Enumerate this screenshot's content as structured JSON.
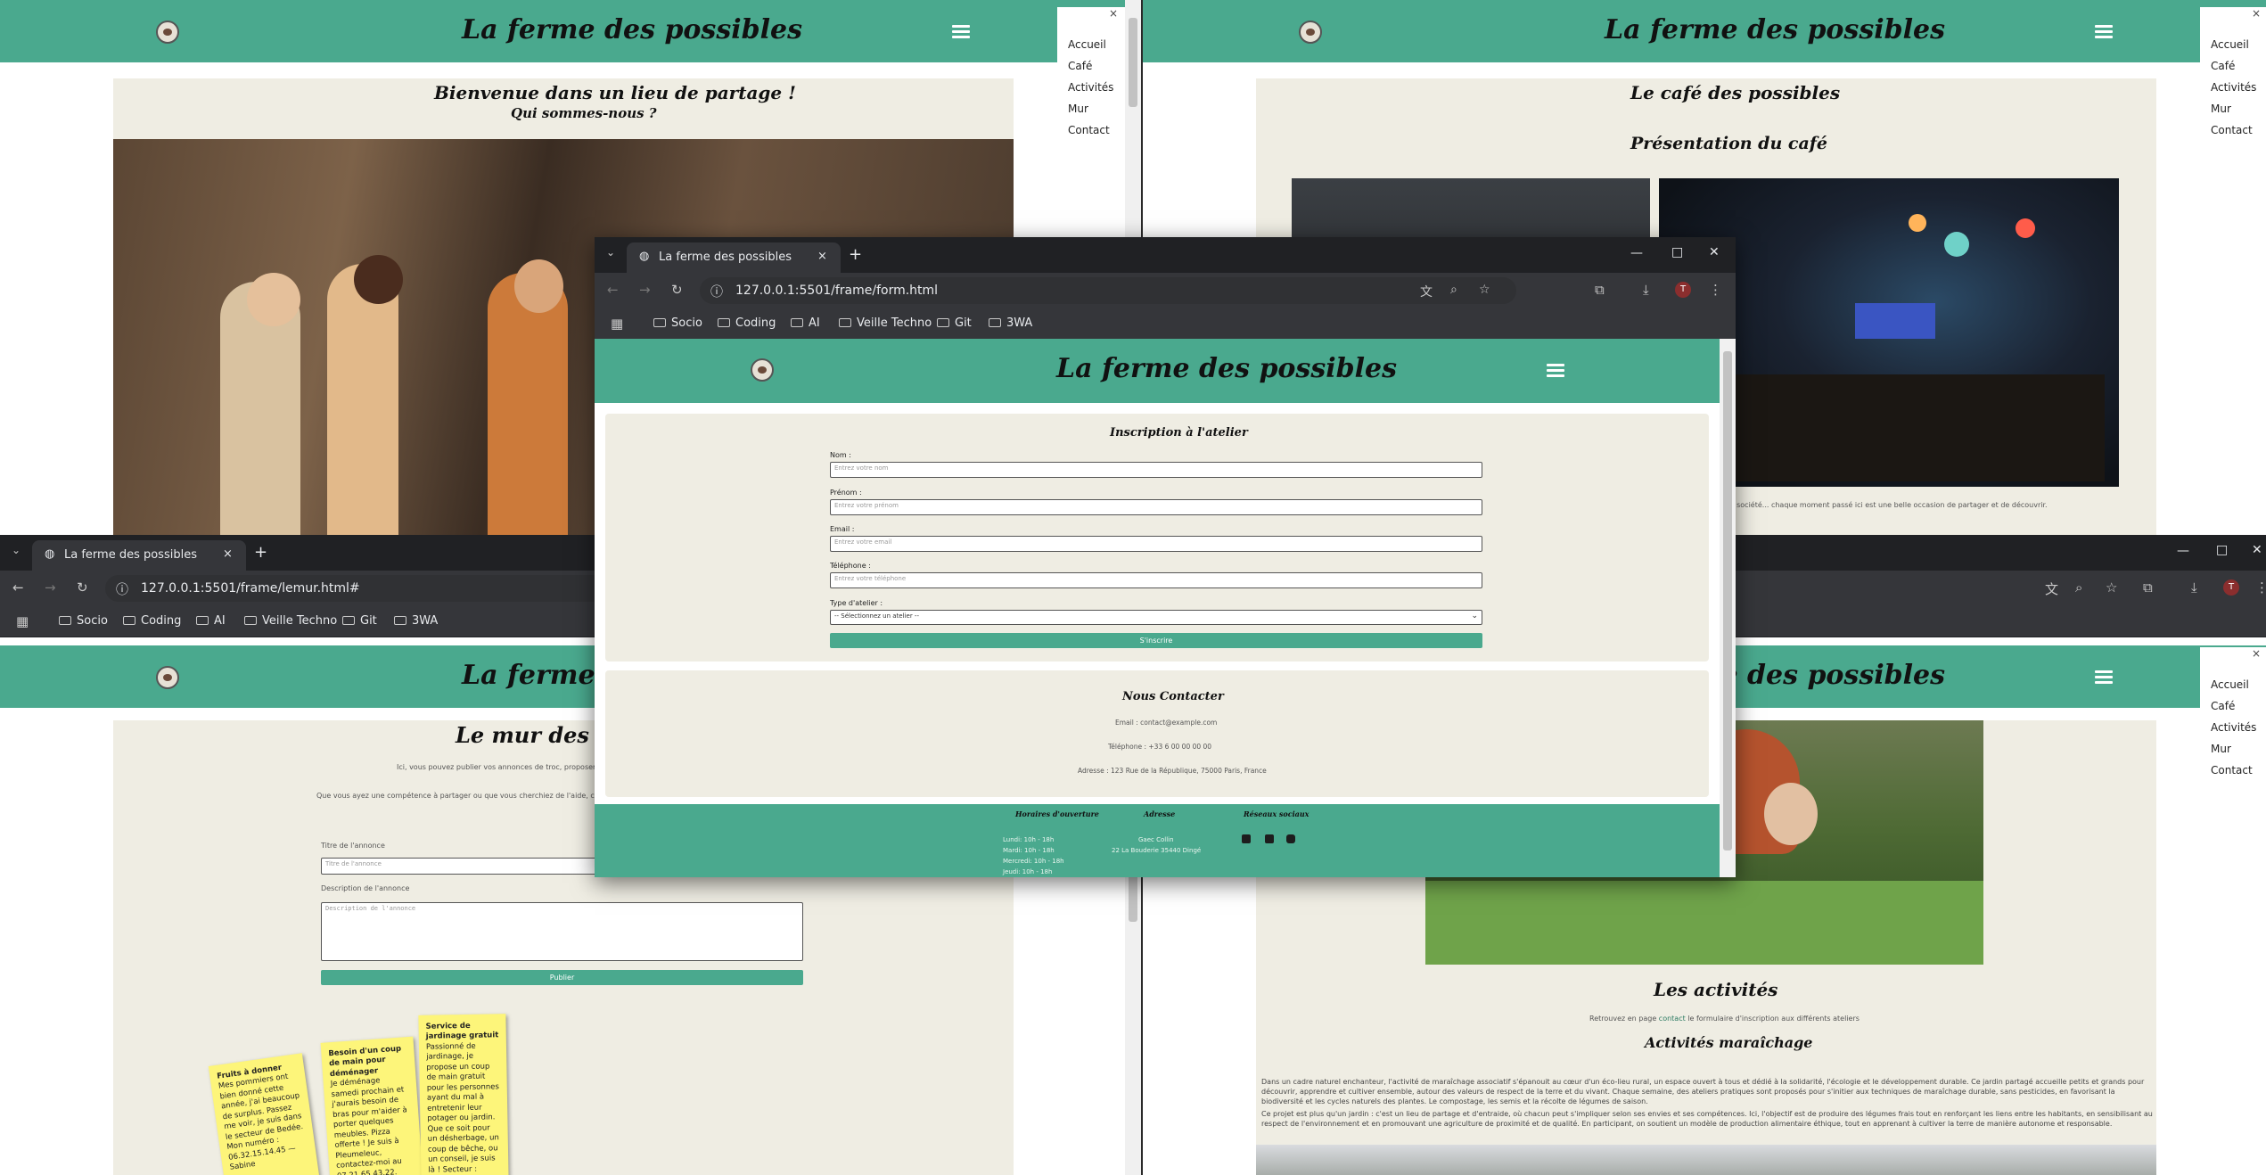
{
  "site": {
    "brand": "La ferme des possibles"
  },
  "nav": {
    "items": [
      "Accueil",
      "Café",
      "Activités",
      "Mur",
      "Contact"
    ],
    "close": "×"
  },
  "win_home": {
    "heading": "Bienvenue dans un lieu de partage !",
    "subheading": "Qui sommes-nous ?"
  },
  "win_cafe": {
    "heading": "Le café des possibles",
    "subheading": "Présentation du café",
    "caption": "arts,lectures, jeux de société... chaque moment passé ici est une belle occasion de partager et de découvrir."
  },
  "win_mur": {
    "tab": {
      "title": "La ferme des possibles",
      "close": "×",
      "new": "+"
    },
    "url": "127.0.0.1:5501/frame/lemur.html#",
    "heading": "Le mur des petites",
    "intro1": "Ici, vous pouvez publier vos annonces de troc, proposer un coup",
    "intro2": "Que vous ayez une compétence à partager ou que vous cherchiez de l'aide, cet espace est",
    "title_label": "Titre de l'annonce",
    "title_placeholder": "Titre de l'annonce",
    "desc_label": "Description de l'annonce",
    "desc_placeholder": "Description de l'annonce",
    "publish": "Publier",
    "notes": [
      {
        "title": "Fruits à donner",
        "body": "Mes pommiers ont bien donné cette année, j'ai beaucoup de surplus. Passez me voir, je suis dans le secteur de Bedée. Mon numéro : 06.32.15.14.45 — Sabine"
      },
      {
        "title": "Besoin d'un coup de main pour déménager",
        "body": "Je déménage samedi prochain et j'aurais besoin de bras pour m'aider à porter quelques meubles. Pizza offerte ! Je suis à Pleumeleuc, contactez-moi au 07.21.65.43.22. Merci !"
      },
      {
        "title": "Service de jardinage gratuit",
        "body": "Passionné de jardinage, je propose un coup de main gratuit pour les personnes ayant du mal à entretenir leur potager ou jardin. Que ce soit pour un désherbage, un coup de bêche, ou un conseil, je suis là ! Secteur : Montfort-sur-"
      }
    ]
  },
  "win_activites": {
    "heading": "Les activités",
    "intro_prefix": "Retrouvez en page ",
    "intro_link": "contact",
    "intro_suffix": " le formulaire d'inscription aux différents ateliers",
    "subheading": "Activités maraîchage",
    "p1": "Dans un cadre naturel enchanteur, l'activité de maraîchage associatif s'épanouit au cœur d'un éco-lieu rural, un espace ouvert à tous et dédié à la solidarité, l'écologie et le développement durable. Ce jardin partagé accueille petits et grands pour découvrir, apprendre et cultiver ensemble, autour des valeurs de respect de la terre et du vivant. Chaque semaine, des ateliers pratiques sont proposés pour s'initier aux techniques de maraîchage durable, sans pesticides, en favorisant la biodiversité et les cycles naturels des plantes. Le compostage, les semis et la récolte de légumes de saison.",
    "p2": "Ce projet est plus qu'un jardin : c'est un lieu de partage et d'entraide, où chacun peut s'impliquer selon ses envies et ses compétences. Ici, l'objectif est de produire des légumes frais tout en renforçant les liens entre les habitants, en sensibilisant au respect de l'environnement et en promouvant une agriculture de proximité et de qualité. En participant, on soutient un modèle de production alimentaire éthique, tout en apprenant à cultiver la terre de manière autonome et responsable."
  },
  "win_form": {
    "tab": {
      "title": "La ferme des possibles",
      "close": "×",
      "new": "+"
    },
    "url": "127.0.0.1:5501/frame/form.html",
    "bookmarks": [
      "Socio",
      "Coding",
      "AI",
      "Veille Techno",
      "Git",
      "3WA"
    ],
    "form_title": "Inscription à l'atelier",
    "fields": [
      {
        "label": "Nom :",
        "placeholder": "Entrez votre nom"
      },
      {
        "label": "Prénom :",
        "placeholder": "Entrez votre prénom"
      },
      {
        "label": "Email :",
        "placeholder": "Entrez votre email"
      },
      {
        "label": "Téléphone :",
        "placeholder": "Entrez votre téléphone"
      }
    ],
    "select_label": "Type d'atelier :",
    "select_value": "-- Sélectionnez un atelier --",
    "submit": "S'inscrire",
    "contact_title": "Nous Contacter",
    "email": "Email : contact@example.com",
    "phone": "Téléphone : +33 6 00 00 00 00",
    "address": "Adresse : 123 Rue de la République, 75000 Paris, France",
    "footer": {
      "hours_title": "Horaires d'ouverture",
      "hours": [
        "Lundi: 10h - 18h",
        "Mardi: 10h - 18h",
        "Mercredi: 10h - 18h",
        "Jeudi: 10h - 18h"
      ],
      "addr_title": "Adresse",
      "addr_lines": [
        "Gaec Collin",
        "22 La Bouderie 35440 Dingé"
      ],
      "social_title": "Réseaux sociaux"
    }
  },
  "bookmarks_mur": [
    "Socio",
    "Coding",
    "AI",
    "Veille Techno",
    "Git",
    "3WA"
  ],
  "colors": {
    "teal": "#4aa98e",
    "cream": "#efede3",
    "chrome": "#202124"
  }
}
